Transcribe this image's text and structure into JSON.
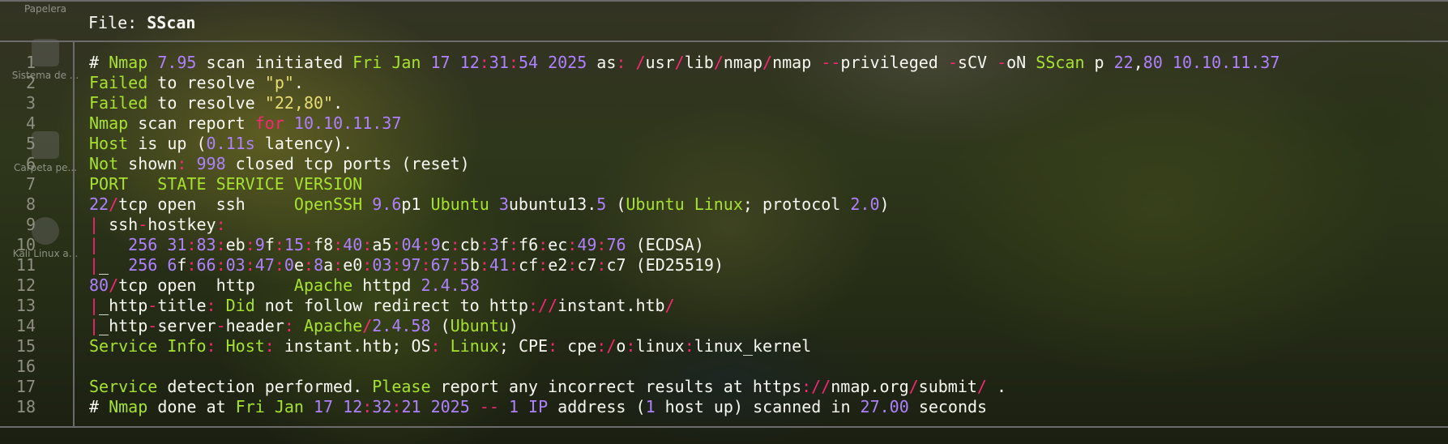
{
  "desktop": {
    "icons": [
      "Papelera",
      "Sistema de ...",
      "Carpeta pe...",
      "Kali Linux a..."
    ]
  },
  "viewer": {
    "file_label": "File: ",
    "file_name": "SScan"
  },
  "line_numbers": [
    "1",
    "2",
    "3",
    "4",
    "5",
    "6",
    "7",
    "8",
    "9",
    "10",
    "11",
    "12",
    "13",
    "14",
    "15",
    "16",
    "17",
    "18"
  ],
  "lines": [
    "# Nmap 7.95 scan initiated Fri Jan 17 12:31:54 2025 as: /usr/lib/nmap/nmap --privileged -sCV -oN SScan p 22,80 10.10.11.37",
    "Failed to resolve \"p\".",
    "Failed to resolve \"22,80\".",
    "Nmap scan report for 10.10.11.37",
    "Host is up (0.11s latency).",
    "Not shown: 998 closed tcp ports (reset)",
    "PORT   STATE SERVICE VERSION",
    "22/tcp open  ssh     OpenSSH 9.6p1 Ubuntu 3ubuntu13.5 (Ubuntu Linux; protocol 2.0)",
    "| ssh-hostkey:",
    "|   256 31:83:eb:9f:15:f8:40:a5:04:9c:cb:3f:f6:ec:49:76 (ECDSA)",
    "|_  256 6f:66:03:47:0e:8a:e0:03:97:67:5b:41:cf:e2:c7:c7 (ED25519)",
    "80/tcp open  http    Apache httpd 2.4.58",
    "|_http-title: Did not follow redirect to http://instant.htb/",
    "|_http-server-header: Apache/2.4.58 (Ubuntu)",
    "Service Info: Host: instant.htb; OS: Linux; CPE: cpe:/o:linux:linux_kernel",
    "",
    "Service detection performed. Please report any incorrect results at https://nmap.org/submit/ .",
    "# Nmap done at Fri Jan 17 12:32:21 2025 -- 1 IP address (1 host up) scanned in 27.00 seconds"
  ],
  "colors": {
    "green": "#a6e22e",
    "purple": "#ae81ff",
    "pink": "#f92672",
    "yellow": "#e6db74",
    "text": "#f8f8f2",
    "line_number": "#8e8e82",
    "border": "#6b6b6b"
  }
}
